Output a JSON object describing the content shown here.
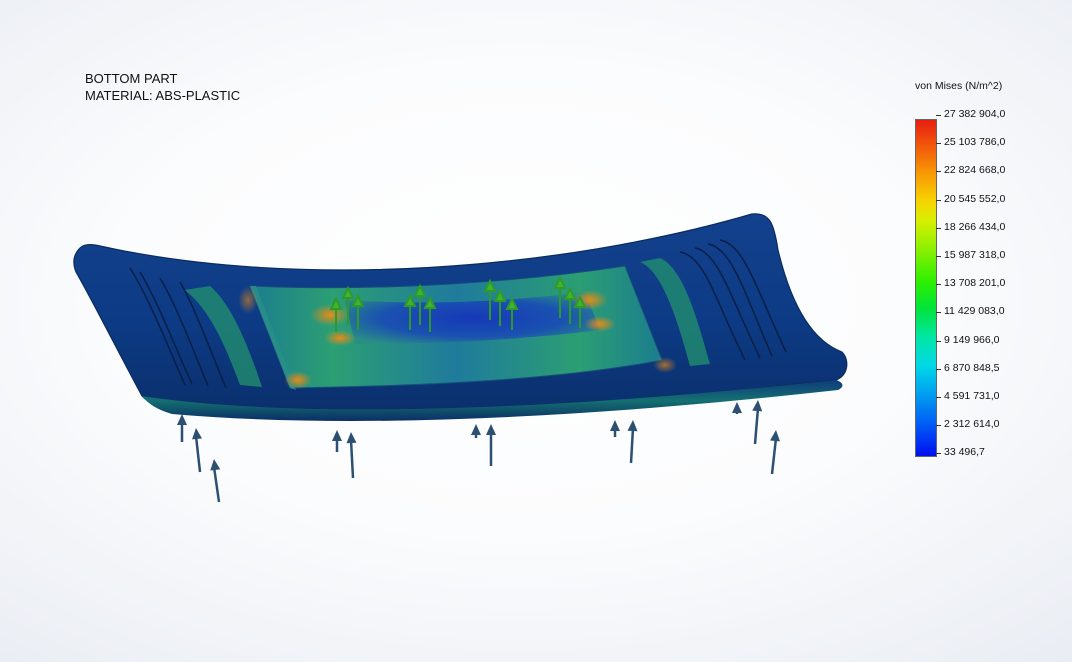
{
  "header": {
    "part": "BOTTOM PART",
    "material": "MATERIAL: ABS-PLASTIC"
  },
  "legend": {
    "title": "von Mises (N/m^2)",
    "labels": [
      "27 382 904,0",
      "25 103 786,0",
      "22 824 668,0",
      "20 545 552,0",
      "18 266 434,0",
      "15 987 318,0",
      "13 708 201,0",
      "11 429 083,0",
      "9 149 966,0",
      "6 870 848,5",
      "4 591 731,0",
      "2 312 614,0",
      "33 496,7"
    ]
  },
  "colors": {
    "arrow": "#2c4f72",
    "part_low": "#0b3a86",
    "part_mid": "#1f8a7a",
    "part_high": "#e07b16",
    "load_marker": "#2f9a2a"
  }
}
